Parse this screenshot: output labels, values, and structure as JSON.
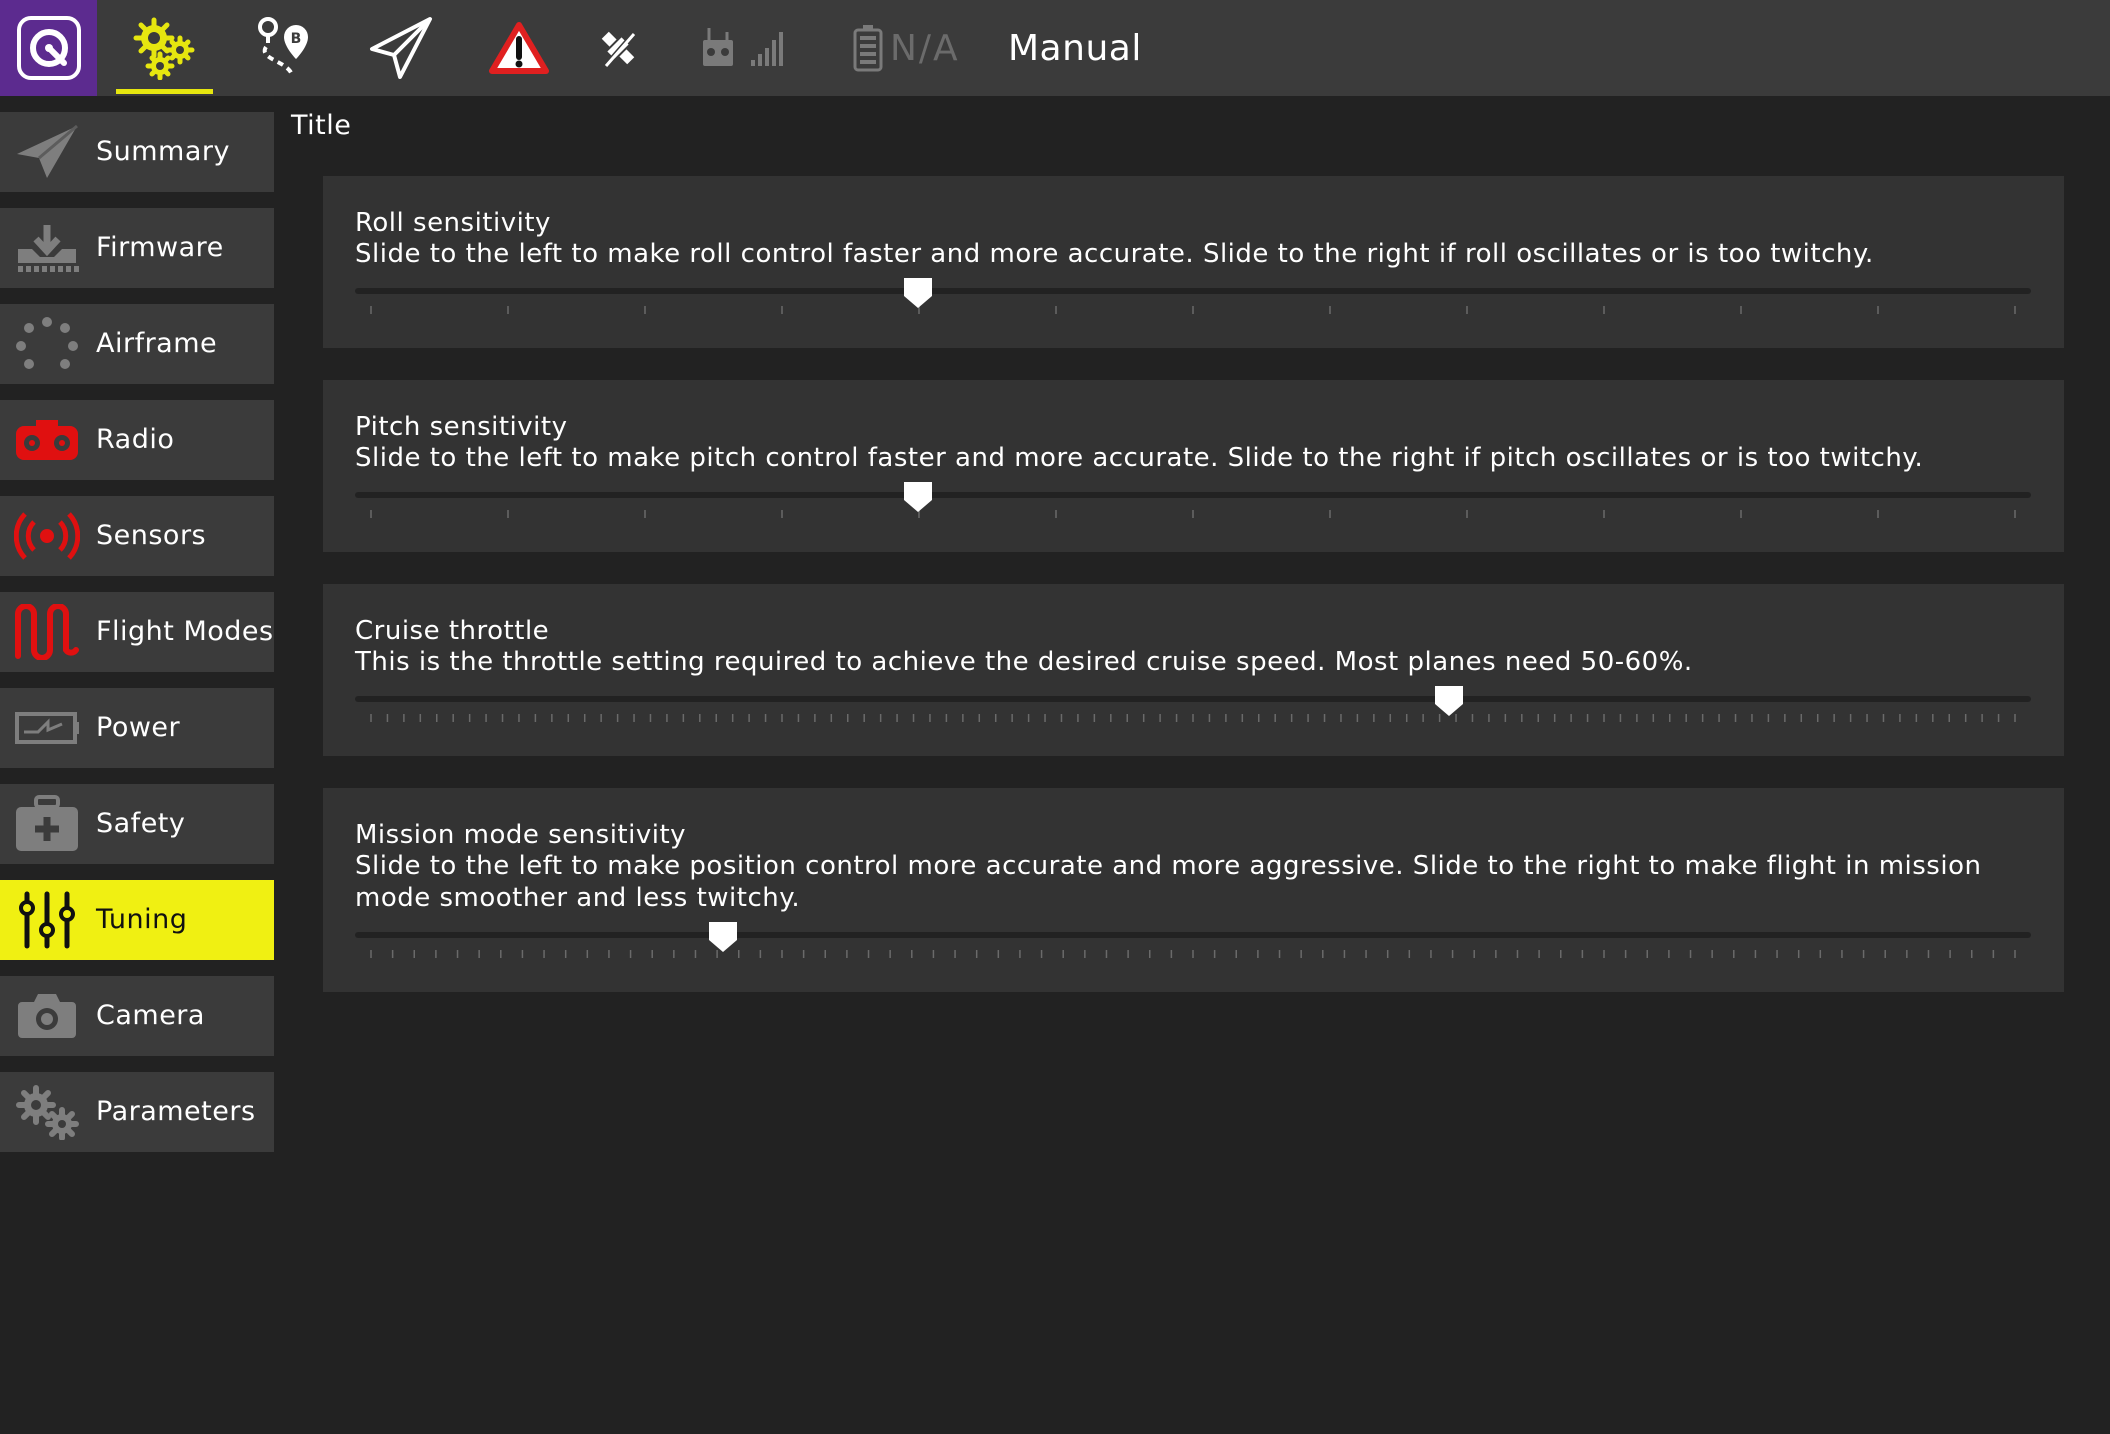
{
  "toolbar": {
    "icons": [
      "qgc-logo-icon",
      "vehicle-setup-icon",
      "plan-view-icon",
      "fly-view-icon",
      "warning-icon",
      "gps-icon",
      "rc-rssi-icon",
      "battery-icon"
    ],
    "battery_text": "N/A",
    "flight_mode": "Manual",
    "accent_color": "#e6e60f",
    "warning_color": "#e02020",
    "logo_bg_color": "#5c2b8f"
  },
  "sidebar": {
    "items": [
      {
        "label": "Summary",
        "icon": "plane-icon"
      },
      {
        "label": "Firmware",
        "icon": "download-icon"
      },
      {
        "label": "Airframe",
        "icon": "airframe-icon"
      },
      {
        "label": "Radio",
        "icon": "radio-icon"
      },
      {
        "label": "Sensors",
        "icon": "sensors-icon"
      },
      {
        "label": "Flight Modes",
        "icon": "flight-modes-icon"
      },
      {
        "label": "Power",
        "icon": "power-icon"
      },
      {
        "label": "Safety",
        "icon": "safety-icon"
      },
      {
        "label": "Tuning",
        "icon": "tuning-icon"
      },
      {
        "label": "Camera",
        "icon": "camera-icon"
      },
      {
        "label": "Parameters",
        "icon": "gears-icon"
      }
    ],
    "active": "Tuning",
    "active_color": "#f0f012",
    "alert_icon_color": "#e01010"
  },
  "main": {
    "title": "Title",
    "panels": [
      {
        "title": "Roll sensitivity",
        "description": "Slide to the left to make roll control faster and more accurate. Slide to the right if roll oscillates or is too twitchy.",
        "value_fraction": 0.333,
        "tick_count": 13
      },
      {
        "title": "Pitch sensitivity",
        "description": "Slide to the left to make pitch control faster and more accurate. Slide to the right if pitch oscillates or is too twitchy.",
        "value_fraction": 0.333,
        "tick_count": 13
      },
      {
        "title": "Cruise throttle",
        "description": "This is the throttle setting required to achieve the desired cruise speed. Most planes need 50-60%.",
        "value_fraction": 0.656,
        "tick_count": 101
      },
      {
        "title": "Mission mode sensitivity",
        "description": "Slide to the left to make position control more accurate and more aggressive. Slide to the right to make flight in mission mode smoother and less twitchy.",
        "value_fraction": 0.214,
        "tick_count": 77
      }
    ]
  }
}
